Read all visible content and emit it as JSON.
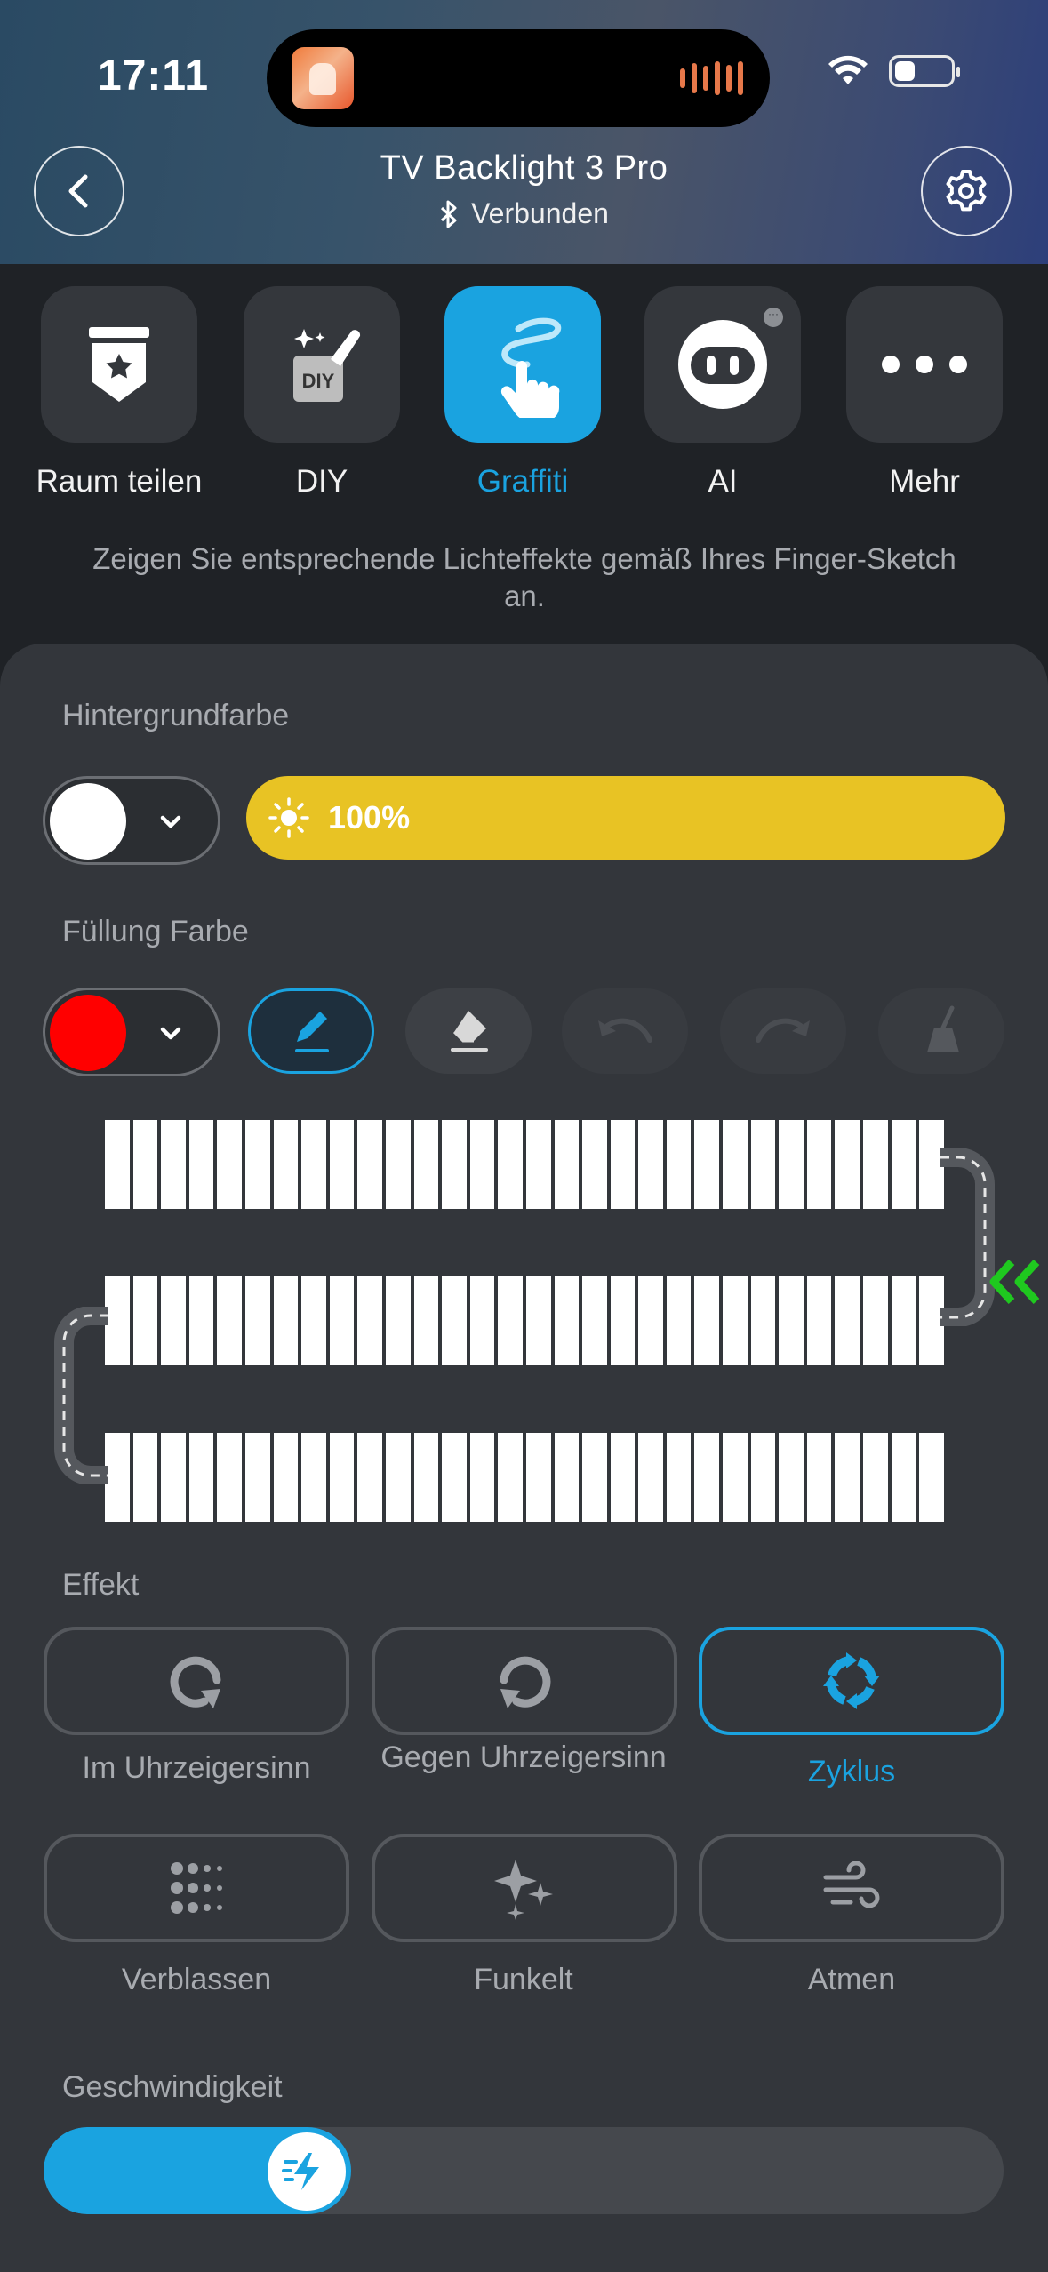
{
  "status_bar": {
    "time": "17:11"
  },
  "header": {
    "title": "TV Backlight 3 Pro",
    "connection": "Verbunden"
  },
  "tabs": [
    {
      "label": "Raum teilen",
      "icon": "share-room-icon",
      "active": false
    },
    {
      "label": "DIY",
      "icon": "diy-icon",
      "active": false
    },
    {
      "label": "Graffiti",
      "icon": "graffiti-finger-icon",
      "active": true
    },
    {
      "label": "AI",
      "icon": "ai-robot-icon",
      "active": false
    },
    {
      "label": "Mehr",
      "icon": "more-dots-icon",
      "active": false
    }
  ],
  "hint": "Zeigen Sie entsprechende Lichteffekte gemäß Ihres Finger-Sketch an.",
  "background": {
    "label": "Hintergrundfarbe",
    "color": "#ffffff",
    "brightness_value": 100,
    "brightness_text": "100%",
    "brightness_color": "#e8c324"
  },
  "fill": {
    "label": "Füllung Farbe",
    "color": "#ff0000",
    "tools": [
      {
        "name": "pen",
        "icon": "pen-icon",
        "active": true
      },
      {
        "name": "eraser",
        "icon": "eraser-icon",
        "active": false
      },
      {
        "name": "undo",
        "icon": "undo-icon",
        "disabled": true
      },
      {
        "name": "redo",
        "icon": "redo-icon",
        "disabled": true
      },
      {
        "name": "clear",
        "icon": "broom-icon",
        "disabled": true
      }
    ]
  },
  "led_strip": {
    "rows": 3,
    "segments_per_row": 30
  },
  "effect": {
    "label": "Effekt",
    "options": [
      {
        "label": "Im Uhrzeigersinn",
        "icon": "clockwise-icon",
        "active": false
      },
      {
        "label": "Gegen Uhrzeigersinn",
        "icon": "counterclockwise-icon",
        "active": false
      },
      {
        "label": "Zyklus",
        "icon": "cycle-icon",
        "active": true
      },
      {
        "label": "Verblassen",
        "icon": "fade-icon",
        "active": false
      },
      {
        "label": "Funkelt",
        "icon": "sparkle-icon",
        "active": false
      },
      {
        "label": "Atmen",
        "icon": "breathe-icon",
        "active": false
      }
    ]
  },
  "speed": {
    "label": "Geschwindigkeit",
    "value": 0.32
  },
  "colors": {
    "accent": "#1aa3e0",
    "panel": "#33363b",
    "background": "#1f2226",
    "arrow": "#1fc81f"
  }
}
